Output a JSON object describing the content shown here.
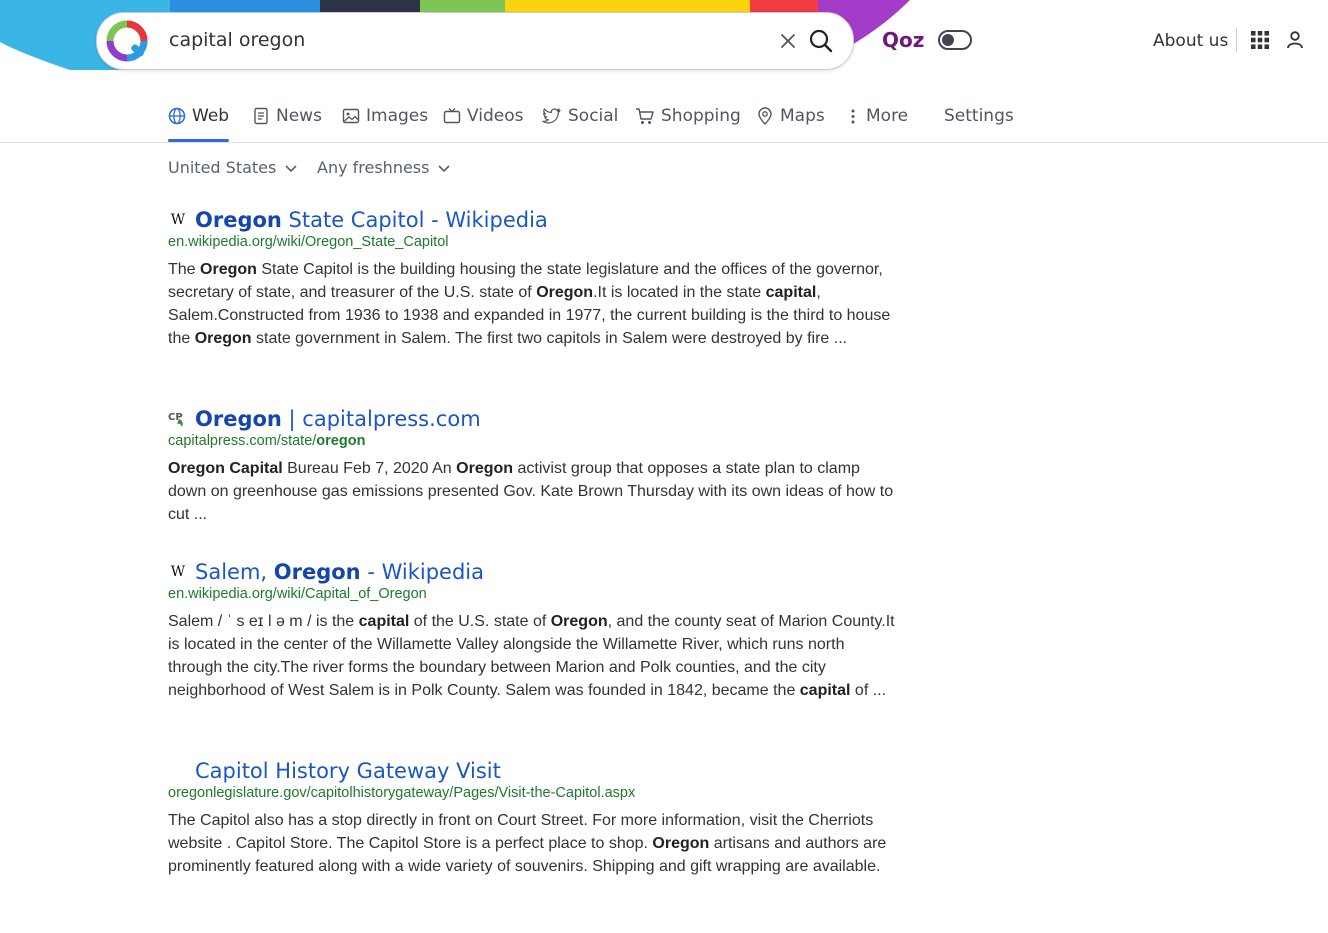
{
  "header": {
    "query": "capital oregon",
    "brand": "Qoz",
    "about_label": "About us"
  },
  "tabs": [
    {
      "label": "Web",
      "icon": "globe-icon",
      "active": true
    },
    {
      "label": "News",
      "icon": "newspaper-icon"
    },
    {
      "label": "Images",
      "icon": "image-icon"
    },
    {
      "label": "Videos",
      "icon": "tv-icon"
    },
    {
      "label": "Social",
      "icon": "twitter-icon"
    },
    {
      "label": "Shopping",
      "icon": "cart-icon"
    },
    {
      "label": "Maps",
      "icon": "map-pin-icon"
    },
    {
      "label": "More",
      "icon": "vertical-dots-icon"
    },
    {
      "label": "Settings"
    }
  ],
  "filters": {
    "region": "United States",
    "freshness": "Any freshness"
  },
  "results": [
    {
      "favicon": "W",
      "title_parts": [
        {
          "t": "Oregon",
          "b": true
        },
        {
          "t": " State Capitol - Wikipedia"
        }
      ],
      "url_parts": [
        {
          "t": "en.wikipedia.org/wiki/Oregon_State_Capitol"
        }
      ],
      "snippet_parts": [
        {
          "t": "The "
        },
        {
          "t": "Oregon",
          "b": true
        },
        {
          "t": " State Capitol is the building housing the state legislature and the offices of the governor, secretary of state, and treasurer of the U.S. state of "
        },
        {
          "t": "Oregon",
          "b": true
        },
        {
          "t": ".It is located in the state "
        },
        {
          "t": "capital",
          "b": true
        },
        {
          "t": ", Salem.Constructed from 1936 to 1938 and expanded in 1977, the current building is the third to house the "
        },
        {
          "t": "Oregon",
          "b": true
        },
        {
          "t": " state government in Salem. The first two capitols in Salem were destroyed by fire ..."
        }
      ]
    },
    {
      "favicon": "CP",
      "title_parts": [
        {
          "t": "Oregon",
          "b": true
        },
        {
          "t": " | capitalpress.com"
        }
      ],
      "url_parts": [
        {
          "t": "capitalpress.com/state/"
        },
        {
          "t": "oregon",
          "b": true
        }
      ],
      "snippet_parts": [
        {
          "t": "Oregon Capital",
          "b": true
        },
        {
          "t": " Bureau Feb 7, 2020 An "
        },
        {
          "t": "Oregon",
          "b": true
        },
        {
          "t": " activist group that opposes a state plan to clamp down on greenhouse gas emissions presented Gov. Kate Brown Thursday with its own ideas of how to cut ..."
        }
      ]
    },
    {
      "favicon": "W",
      "title_parts": [
        {
          "t": "Salem, "
        },
        {
          "t": "Oregon",
          "b": true
        },
        {
          "t": " - Wikipedia"
        }
      ],
      "url_parts": [
        {
          "t": "en.wikipedia.org/wiki/Capital_of_Oregon"
        }
      ],
      "snippet_parts": [
        {
          "t": "Salem / ˈ s eɪ l ə m / is the "
        },
        {
          "t": "capital",
          "b": true
        },
        {
          "t": " of the U.S. state of "
        },
        {
          "t": "Oregon",
          "b": true
        },
        {
          "t": ", and the county seat of Marion County.It is located in the center of the Willamette Valley alongside the Willamette River, which runs north through the city.The river forms the boundary between Marion and Polk counties, and the city neighborhood of West Salem is in Polk County. Salem was founded in 1842, became the "
        },
        {
          "t": "capital",
          "b": true
        },
        {
          "t": " of ..."
        }
      ]
    },
    {
      "favicon": "",
      "title_parts": [
        {
          "t": "Capitol History Gateway Visit"
        }
      ],
      "url_parts": [
        {
          "t": "oregonlegislature.gov/capitolhistorygateway/Pages/Visit-the-Capitol.aspx"
        }
      ],
      "snippet_parts": [
        {
          "t": "The Capitol also has a stop directly in front on Court Street. For more information, visit the Cherriots website . Capitol Store. The Capitol Store is a perfect place to shop. "
        },
        {
          "t": "Oregon",
          "b": true
        },
        {
          "t": " artisans and authors are prominently featured along with a wide variety of souvenirs. Shipping and gift wrapping are available."
        }
      ]
    }
  ]
}
